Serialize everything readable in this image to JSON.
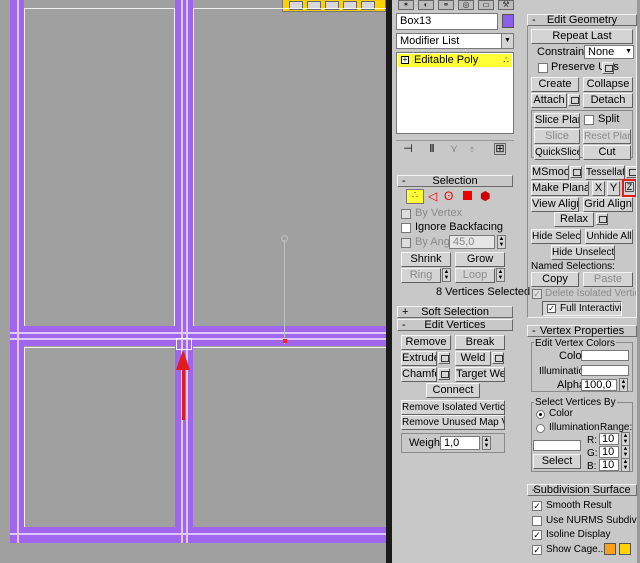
{
  "modifier_stack": {
    "object_name": "Box13",
    "modifier_list": "Modifier List",
    "stack_item": "Editable Poly",
    "stack_item_icon": "plus-box-icon",
    "object_color": "#8d5fee"
  },
  "selection": {
    "title": "Selection",
    "by_vertex": "By Vertex",
    "ignore_backfacing": "Ignore Backfacing",
    "by_angle": "By Angle:",
    "by_angle_value": "45,0",
    "shrink": "Shrink",
    "grow": "Grow",
    "ring": "Ring",
    "loop": "Loop",
    "status": "8 Vertices Selected"
  },
  "soft_selection": {
    "title": "Soft Selection"
  },
  "edit_vertices": {
    "title": "Edit Vertices",
    "remove": "Remove",
    "break": "Break",
    "extrude": "Extrude",
    "weld": "Weld",
    "chamfer": "Chamfer",
    "target_weld": "Target Weld",
    "connect": "Connect",
    "remove_isolated": "Remove Isolated Vertices",
    "remove_unused": "Remove Unused Map Verts",
    "weight_label": "Weight:",
    "weight_value": "1,0"
  },
  "edit_geometry": {
    "title": "Edit Geometry",
    "repeat_last": "Repeat Last",
    "constraints_label": "Constraints:",
    "constraints_value": "None",
    "preserve_uvs": "Preserve UVs",
    "create": "Create",
    "collapse": "Collapse",
    "attach": "Attach",
    "detach": "Detach",
    "slice_plane": "Slice Plane",
    "split": "Split",
    "slice": "Slice",
    "reset_plane": "Reset Plane",
    "quickslice": "QuickSlice",
    "cut": "Cut",
    "msmooth": "MSmooth",
    "tessellate": "Tessellate",
    "make_planar": "Make Planar",
    "x": "X",
    "y": "Y",
    "z": "Z",
    "view_align": "View Align",
    "grid_align": "Grid Align",
    "relax": "Relax",
    "hide_selected": "Hide Selected",
    "unhide_all": "Unhide All",
    "hide_unselected": "Hide Unselected",
    "named_selections": "Named Selections:",
    "copy": "Copy",
    "paste": "Paste",
    "delete_isolated": "Delete Isolated Vertices",
    "full_interactivity": "Full Interactivity"
  },
  "vertex_properties": {
    "title": "Vertex Properties",
    "edit_vertex_colors": "Edit Vertex Colors",
    "color": "Color:",
    "illumination": "Illumination:",
    "alpha": "Alpha:",
    "alpha_value": "100,0",
    "select_vertices_by": "Select Vertices By",
    "opt_color": "Color",
    "opt_illumination": "Illumination",
    "range": "Range:",
    "r": "R:",
    "g": "G:",
    "b": "B:",
    "r_value": "10",
    "g_value": "10",
    "b_value": "10",
    "select": "Select"
  },
  "subdivision_surface": {
    "title": "Subdivision Surface",
    "smooth_result": "Smooth Result",
    "use_nurms": "Use NURMS Subdivision",
    "isoline_display": "Isoline Display",
    "show_cage": "Show Cage......",
    "cage_color_1": "#f7a11a",
    "cage_color_2": "#ffd400"
  },
  "colors": {
    "viewport_bg": "#a0a0a0",
    "mesh": "#a066ee",
    "panel_bg": "#c8c8c8",
    "stack_highlight": "#ffff33",
    "annotation_arrow": "#e21b1b"
  }
}
